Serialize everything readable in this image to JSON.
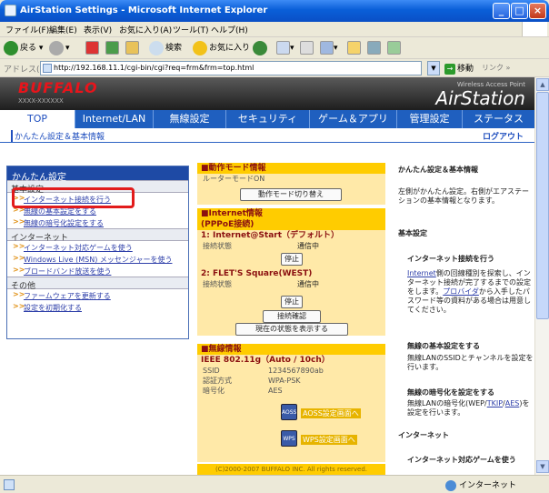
{
  "window": {
    "title": "AirStation Settings - Microsoft Internet Explorer"
  },
  "menu": [
    "ファイル(F)",
    "編集(E)",
    "表示(V)",
    "お気に入り(A)",
    "ツール(T)",
    "ヘルプ(H)"
  ],
  "toolbar": {
    "back": "戻る",
    "search": "検索",
    "favorites": "お気に入り"
  },
  "address": {
    "label": "アドレス(D)",
    "url": "http://192.168.11.1/cgi-bin/cgi?req=frm&frm=top.html",
    "go": "移動",
    "links": "リンク »"
  },
  "header": {
    "logo": "BUFFALO",
    "model": "XXXX-XXXXXX",
    "tagline": "Wireless Access Point",
    "product": "AirStation"
  },
  "tabs": [
    "TOP",
    "Internet/LAN",
    "無線設定",
    "セキュリティ",
    "ゲーム＆アプリ",
    "管理設定",
    "ステータス"
  ],
  "subnav": {
    "current": "かんたん設定＆基本情報",
    "logout": "ログアウト"
  },
  "left": {
    "title": "かんたん設定",
    "sections": [
      {
        "name": "基本設定",
        "items": [
          "インターネット接続を行う",
          "無線の基本設定をする",
          "無線の暗号化設定をする"
        ]
      },
      {
        "name": "インターネット",
        "items": [
          "インターネット対応ゲームを使う",
          "Windows Live (MSN) メッセンジャーを使う",
          "ブロードバンド放送を使う"
        ]
      },
      {
        "name": "その他",
        "items": [
          "ファームウェアを更新する",
          "設定を初期化する"
        ]
      }
    ]
  },
  "mode": {
    "title": "■動作モード情報",
    "value": "ルーターモードON",
    "button": "動作モード切り替え"
  },
  "internet": {
    "title": "■Internet情報",
    "subtitle": "(PPPoE接続)",
    "conn1": {
      "name": "1: Internet@Start（デフォルト）",
      "label": "接続状態",
      "status": "通信中",
      "button": "停止"
    },
    "conn2": {
      "name": "2: FLET'S Square(WEST)",
      "label": "接続状態",
      "status": "通信中",
      "button": "停止"
    },
    "check_button": "接続確認",
    "show_button": "現在の状態を表示する"
  },
  "wireless": {
    "title": "■無線情報",
    "standard": "IEEE 802.11g（Auto / 10ch）",
    "rows": [
      {
        "k": "SSID",
        "v": "1234567890ab"
      },
      {
        "k": "認証方式",
        "v": "WPA-PSK"
      },
      {
        "k": "暗号化",
        "v": "AES"
      }
    ],
    "aoss": "AOSS設定画面へ",
    "aoss_icon": "AOSS",
    "wps": "WPS設定画面へ",
    "wps_icon": "WPS"
  },
  "footer": "(C)2000-2007 BUFFALO INC. All rights reserved.",
  "help": {
    "title": "かんたん設定＆基本情報",
    "intro": "左側がかんたん設定。右側がエアステーションの基本情報となります。",
    "h_basic": "基本設定",
    "h_inet": "インターネット接続を行う",
    "p_inet_link1": "Internet",
    "p_inet1": "側の回線種別を探索し、インターネット接続が完了するまでの設定をします。",
    "p_inet_link2": "プロバイダ",
    "p_inet2": "から入手したパスワード等の資料がある場合は用意してください。",
    "h_wbasic": "無線の基本設定をする",
    "p_wbasic": "無線LANのSSIDとチャンネルを設定を行います。",
    "h_wenc": "無線の暗号化を設定をする",
    "p_wenc_pre": "無線LANの暗号化(WEP/",
    "p_wenc_link1": "TKIP",
    "p_wenc_mid": "/",
    "p_wenc_link2": "AES",
    "p_wenc_post": ")を設定を行います。",
    "h_internet": "インターネット",
    "h_game": "インターネット対応ゲームを使う"
  },
  "status": {
    "zone": "インターネット"
  }
}
